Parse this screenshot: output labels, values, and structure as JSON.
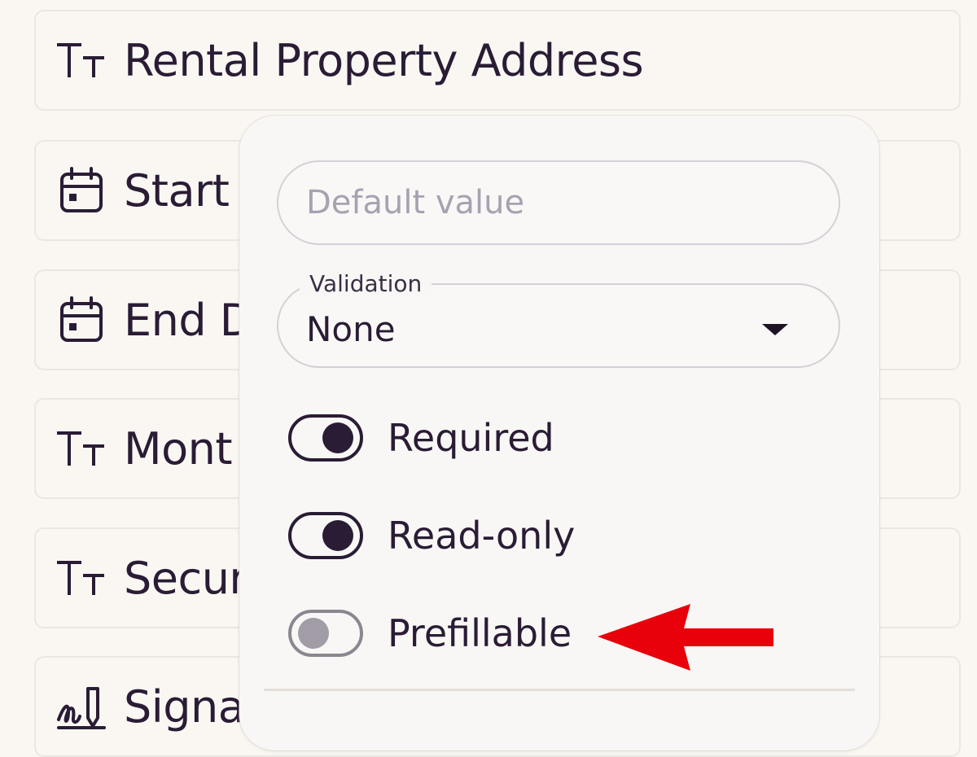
{
  "fields": [
    {
      "icon": "text-type-icon",
      "label": "Rental Property Address"
    },
    {
      "icon": "calendar-icon",
      "label": "Start"
    },
    {
      "icon": "calendar-icon",
      "label": "End D"
    },
    {
      "icon": "text-type-icon",
      "label": "Mont"
    },
    {
      "icon": "text-type-icon",
      "label": "Secur"
    },
    {
      "icon": "signature-icon",
      "label": "Signa"
    }
  ],
  "popover": {
    "default_value_placeholder": "Default value",
    "validation": {
      "legend": "Validation",
      "value": "None"
    },
    "toggles": [
      {
        "label": "Required",
        "on": true
      },
      {
        "label": "Read-only",
        "on": true
      },
      {
        "label": "Prefillable",
        "on": false
      }
    ]
  },
  "annotation": {
    "arrow_color": "#e8000b",
    "points_to": "Prefillable"
  },
  "colors": {
    "background": "#faf7f3",
    "text": "#2a1c35",
    "border": "#ebe6e0"
  }
}
